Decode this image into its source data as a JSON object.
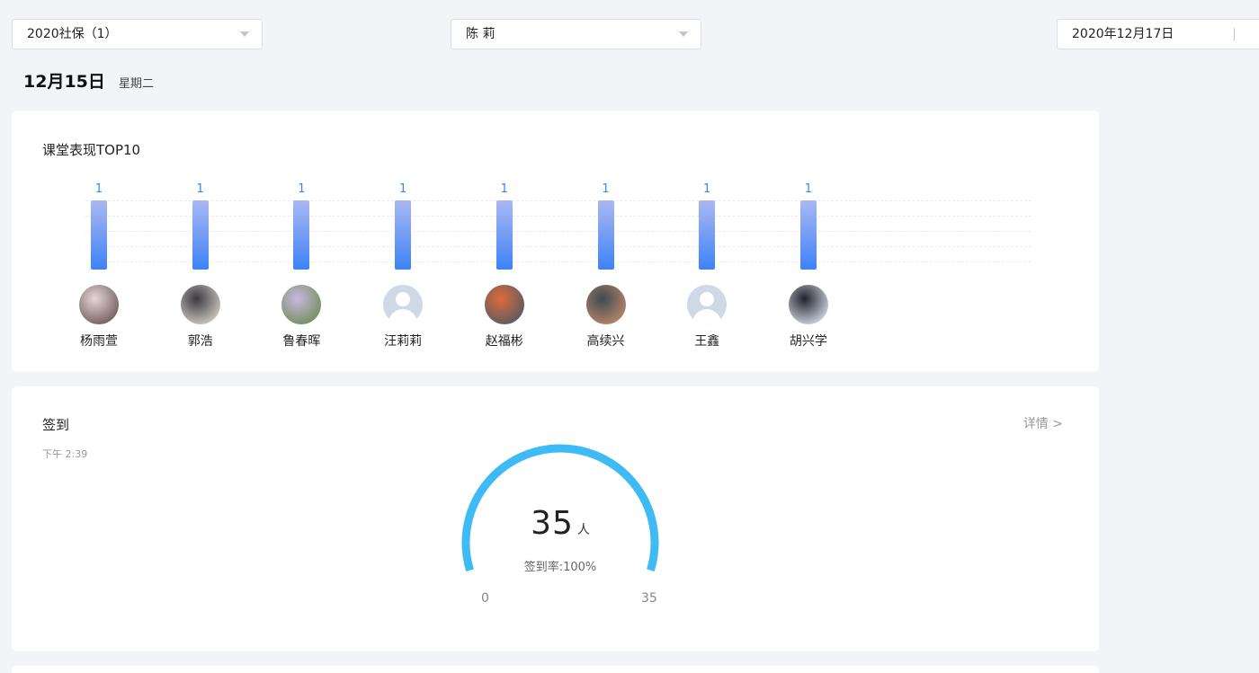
{
  "filters": {
    "class_select": "2020社保（1）",
    "teacher_select": "陈 莉",
    "date": "2020年12月17日"
  },
  "heading": {
    "date": "12月15日",
    "weekday": "星期二"
  },
  "top10": {
    "title": "课堂表现TOP10",
    "chart_data": {
      "type": "bar",
      "categories": [
        "杨雨萱",
        "郭浩",
        "鲁春晖",
        "汪莉莉",
        "赵福彬",
        "高续兴",
        "王鑫",
        "胡兴学"
      ],
      "values": [
        1,
        1,
        1,
        1,
        1,
        1,
        1,
        1
      ],
      "ylim": [
        0,
        1
      ]
    },
    "avatars": [
      "photo",
      "photo",
      "photo",
      "default",
      "photo",
      "photo",
      "default",
      "photo"
    ],
    "colors": {
      "bar_top": "#aab8f3",
      "bar_bottom": "#3d82f6",
      "value_label": "#3a86f0"
    }
  },
  "signin": {
    "title": "签到",
    "time": "下午 2:39",
    "detail_link": "详情 >",
    "count": "35",
    "unit": "人",
    "rate_text": "签到率:100%",
    "gauge_min": "0",
    "gauge_max": "35",
    "gauge_value": 35,
    "gauge_color": "#3ebaf5"
  }
}
